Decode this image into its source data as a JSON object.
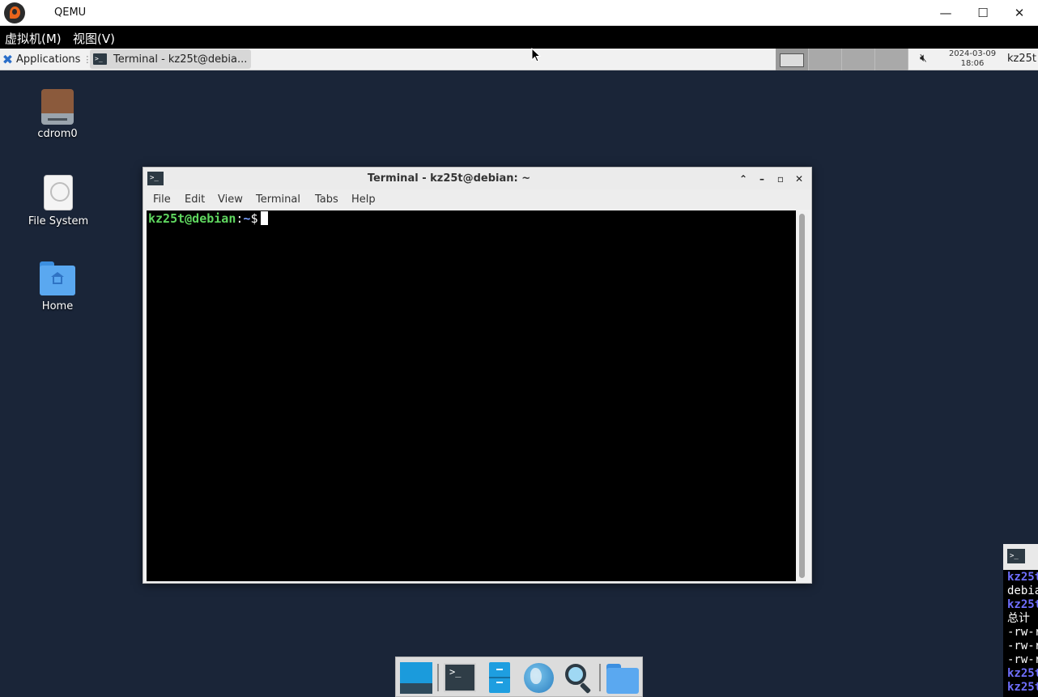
{
  "qemu": {
    "title": "QEMU",
    "menu": [
      "虚拟机(M)",
      "视图(V)"
    ],
    "minimize": "—",
    "maximize": "☐",
    "close": "✕"
  },
  "panel": {
    "applications": "Applications",
    "task_title": "Terminal - kz25t@debia...",
    "date": "2024-03-09",
    "time": "18:06",
    "user": "kz25t",
    "mute_icon": "volume-muted-icon"
  },
  "desktop": {
    "icons": [
      {
        "label": "cdrom0",
        "icon": "cdrom-icon"
      },
      {
        "label": "File System",
        "icon": "drive-icon"
      },
      {
        "label": "Home",
        "icon": "home-folder-icon"
      }
    ]
  },
  "terminal": {
    "title": "Terminal - kz25t@debian: ~",
    "menu": [
      "File",
      "Edit",
      "View",
      "Terminal",
      "Tabs",
      "Help"
    ],
    "prompt_user": "kz25t@debian",
    "prompt_sep": ":",
    "prompt_path": "~",
    "prompt_dollar": "$"
  },
  "side_terminal": {
    "lines": [
      "kz25t",
      "debia",
      "kz25t",
      "总计",
      "-rw-r",
      "-rw-r",
      "-rw-r",
      "kz25t",
      "kz25t"
    ]
  },
  "dock": {
    "items": [
      "show-desktop",
      "terminal",
      "file-manager",
      "web-browser",
      "app-finder",
      "home-folder"
    ]
  }
}
